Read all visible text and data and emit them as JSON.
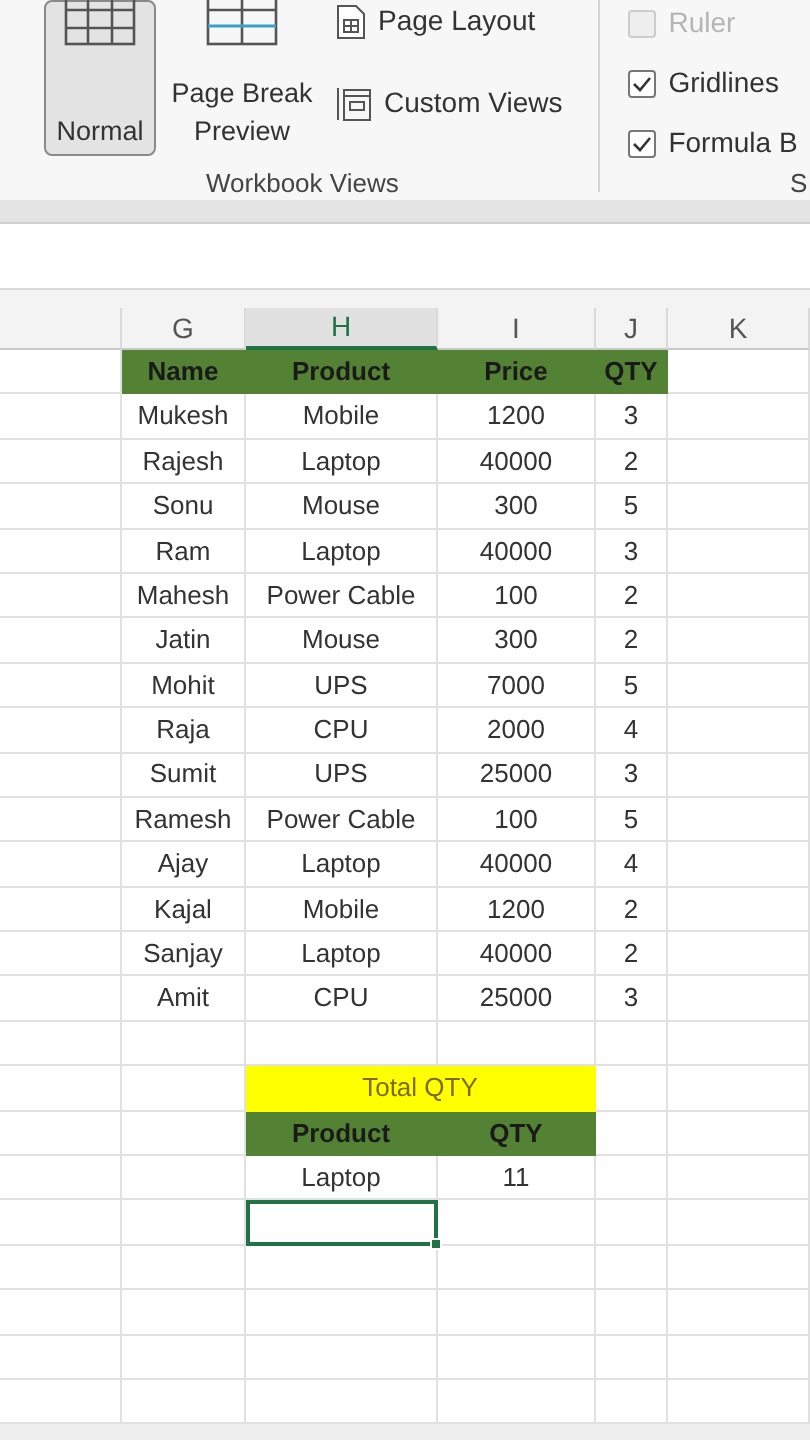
{
  "ribbon": {
    "views": [
      {
        "label": "Normal",
        "selected": true
      },
      {
        "label": "Page Break Preview",
        "selected": false
      }
    ],
    "layout_items": [
      "Page Layout",
      "Custom Views"
    ],
    "group_label": "Workbook Views",
    "show_options": [
      {
        "label": "Ruler",
        "checked": false,
        "disabled": true
      },
      {
        "label": "Gridlines",
        "checked": true,
        "disabled": false
      },
      {
        "label": "Formula B",
        "checked": true,
        "disabled": false
      }
    ],
    "next_group_label": "S"
  },
  "sheet": {
    "columns": [
      {
        "label": "G",
        "selected": false
      },
      {
        "label": "H",
        "selected": true
      },
      {
        "label": "I",
        "selected": false
      },
      {
        "label": "J",
        "selected": false
      },
      {
        "label": "K",
        "selected": false
      }
    ],
    "table": {
      "columns": [
        "Name",
        "Product",
        "Price",
        "QTY"
      ],
      "rows": [
        [
          "Mukesh",
          "Mobile",
          "1200",
          "3"
        ],
        [
          "Rajesh",
          "Laptop",
          "40000",
          "2"
        ],
        [
          "Sonu",
          "Mouse",
          "300",
          "5"
        ],
        [
          "Ram",
          "Laptop",
          "40000",
          "3"
        ],
        [
          "Mahesh",
          "Power Cable",
          "100",
          "2"
        ],
        [
          "Jatin",
          "Mouse",
          "300",
          "2"
        ],
        [
          "Mohit",
          "UPS",
          "7000",
          "5"
        ],
        [
          "Raja",
          "CPU",
          "2000",
          "4"
        ],
        [
          "Sumit",
          "UPS",
          "25000",
          "3"
        ],
        [
          "Ramesh",
          "Power Cable",
          "100",
          "5"
        ],
        [
          "Ajay",
          "Laptop",
          "40000",
          "4"
        ],
        [
          "Kajal",
          "Mobile",
          "1200",
          "2"
        ],
        [
          "Sanjay",
          "Laptop",
          "40000",
          "2"
        ],
        [
          "Amit",
          "CPU",
          "25000",
          "3"
        ]
      ]
    },
    "summary": {
      "title": "Total QTY",
      "columns": [
        "Product",
        "QTY"
      ],
      "rows": [
        [
          "Laptop",
          "11"
        ]
      ],
      "active_cell_below": true
    }
  }
}
